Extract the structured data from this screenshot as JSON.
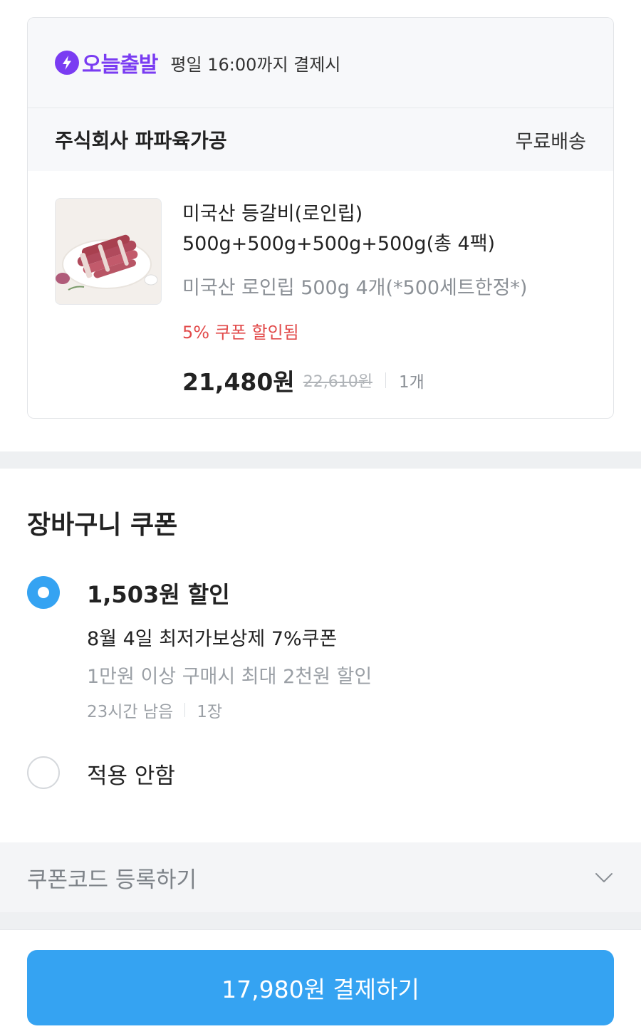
{
  "order": {
    "delivery": {
      "brand": "오늘출발",
      "note": "평일 16:00까지 결제시",
      "icon": "lightning-bolt-icon",
      "brand_color": "#7a3cf2"
    },
    "seller": {
      "name": "주식회사 파파육가공",
      "shipping": "무료배송"
    },
    "product": {
      "title_line1": "미국산 등갈비(로인립)",
      "title_line2": "500g+500g+500g+500g(총 4팩)",
      "option": "미국산 로인립 500g 4개(*500세트한정*)",
      "coupon_applied": "5% 쿠폰 할인됨",
      "price": "21,480원",
      "original_price": "22,610원",
      "quantity": "1개"
    }
  },
  "coupons": {
    "heading": "장바구니 쿠폰",
    "options": [
      {
        "selected": true,
        "discount": "1,503원 할인",
        "name": "8월 4일 최저가보상제 7%쿠폰",
        "condition": "1만원 이상 구매시 최대 2천원 할인",
        "time_left": "23시간 남음",
        "count": "1장"
      },
      {
        "selected": false,
        "label": "적용 안함"
      }
    ],
    "code_register": "쿠폰코드 등록하기"
  },
  "checkout": {
    "button_label": "17,980원 결제하기",
    "accent": "#35a3f2"
  },
  "colors": {
    "discount_red": "#e24b4b",
    "muted_text": "#9ba0a6"
  }
}
